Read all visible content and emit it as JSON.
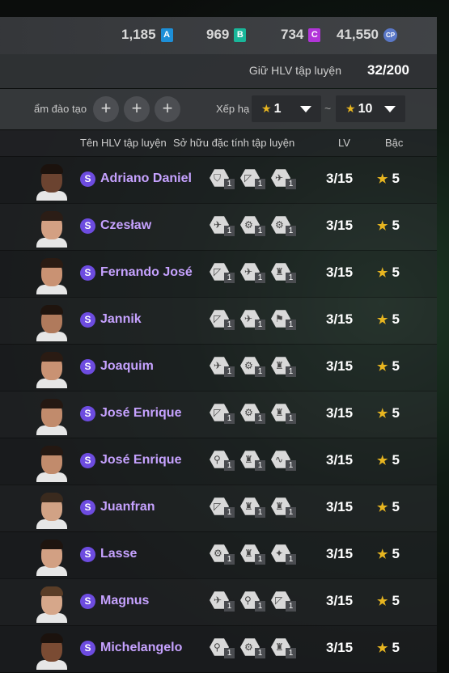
{
  "currency": [
    {
      "value": "1,185",
      "badge": "A",
      "type": "a"
    },
    {
      "value": "969",
      "badge": "B",
      "type": "b"
    },
    {
      "value": "734",
      "badge": "C",
      "type": "c"
    },
    {
      "value": "41,550",
      "badge": "CP",
      "type": "cp"
    }
  ],
  "coach_bar": {
    "label": "Giữ HLV tập luyện",
    "count": "32/200"
  },
  "filter": {
    "training_label": "ẩm đào tạo",
    "plus_symbol": "+",
    "rank_label": "Xếp hạ",
    "min_value": "1",
    "max_value": "10",
    "tilde": "~",
    "star": "★"
  },
  "columns": {
    "name": "Tên HLV tập luyện",
    "traits": "Sở hữu đặc tính tập luyện",
    "lv": "LV",
    "grade": "Bậc"
  },
  "rows": [
    {
      "badge": "S",
      "name": "Adriano Daniel",
      "traits": [
        {
          "icon": "⛉",
          "lvl": "1"
        },
        {
          "icon": "◸",
          "lvl": "1"
        },
        {
          "icon": "✈",
          "lvl": "1"
        }
      ],
      "lv": "3/15",
      "grade": "5",
      "skin": "#6b4330",
      "hair": "#1b120d"
    },
    {
      "badge": "S",
      "name": "Czesław",
      "traits": [
        {
          "icon": "✈",
          "lvl": "1"
        },
        {
          "icon": "⚙",
          "lvl": "1"
        },
        {
          "icon": "⚙",
          "lvl": "1"
        }
      ],
      "lv": "3/15",
      "grade": "5",
      "skin": "#d3a083",
      "hair": "#2b1d16"
    },
    {
      "badge": "S",
      "name": "Fernando José",
      "traits": [
        {
          "icon": "◸",
          "lvl": "1"
        },
        {
          "icon": "✈",
          "lvl": "1"
        },
        {
          "icon": "♜",
          "lvl": "1"
        }
      ],
      "lv": "3/15",
      "grade": "5",
      "skin": "#c99273",
      "hair": "#2a1b13"
    },
    {
      "badge": "S",
      "name": "Jannik",
      "traits": [
        {
          "icon": "◸",
          "lvl": "1"
        },
        {
          "icon": "✈",
          "lvl": "1"
        },
        {
          "icon": "⚑",
          "lvl": "1"
        }
      ],
      "lv": "3/15",
      "grade": "5",
      "skin": "#b07a5c",
      "hair": "#1f140e"
    },
    {
      "badge": "S",
      "name": "Joaquim",
      "traits": [
        {
          "icon": "✈",
          "lvl": "1"
        },
        {
          "icon": "⚙",
          "lvl": "1"
        },
        {
          "icon": "♜",
          "lvl": "1"
        }
      ],
      "lv": "3/15",
      "grade": "5",
      "skin": "#c99273",
      "hair": "#2a1b13"
    },
    {
      "badge": "S",
      "name": "José Enrique",
      "traits": [
        {
          "icon": "◸",
          "lvl": "1"
        },
        {
          "icon": "⚙",
          "lvl": "1"
        },
        {
          "icon": "♜",
          "lvl": "1"
        }
      ],
      "lv": "3/15",
      "grade": "5",
      "skin": "#c18b6c",
      "hair": "#241812"
    },
    {
      "badge": "S",
      "name": "José Enrique",
      "traits": [
        {
          "icon": "⚲",
          "lvl": "1"
        },
        {
          "icon": "♜",
          "lvl": "1"
        },
        {
          "icon": "∿",
          "lvl": "1"
        }
      ],
      "lv": "3/15",
      "grade": "5",
      "skin": "#c18b6c",
      "hair": "#241812"
    },
    {
      "badge": "S",
      "name": "Juanfran",
      "traits": [
        {
          "icon": "◸",
          "lvl": "1"
        },
        {
          "icon": "♜",
          "lvl": "1"
        },
        {
          "icon": "♜",
          "lvl": "1"
        }
      ],
      "lv": "3/15",
      "grade": "5",
      "skin": "#d1a285",
      "hair": "#3a2a1e"
    },
    {
      "badge": "S",
      "name": "Lasse",
      "traits": [
        {
          "icon": "⚙",
          "lvl": "1"
        },
        {
          "icon": "♜",
          "lvl": "1"
        },
        {
          "icon": "✦",
          "lvl": "1"
        }
      ],
      "lv": "3/15",
      "grade": "5",
      "skin": "#d2a083",
      "hair": "#1d140f"
    },
    {
      "badge": "S",
      "name": "Magnus",
      "traits": [
        {
          "icon": "✈",
          "lvl": "1"
        },
        {
          "icon": "⚲",
          "lvl": "1"
        },
        {
          "icon": "◸",
          "lvl": "1"
        }
      ],
      "lv": "3/15",
      "grade": "5",
      "skin": "#d6a78a",
      "hair": "#5a3d27"
    },
    {
      "badge": "S",
      "name": "Michelangelo",
      "traits": [
        {
          "icon": "⚲",
          "lvl": "1"
        },
        {
          "icon": "⚙",
          "lvl": "1"
        },
        {
          "icon": "♜",
          "lvl": "1"
        }
      ],
      "lv": "3/15",
      "grade": "5",
      "skin": "#7a4b33",
      "hair": "#1b120d"
    }
  ],
  "star_symbol": "★"
}
